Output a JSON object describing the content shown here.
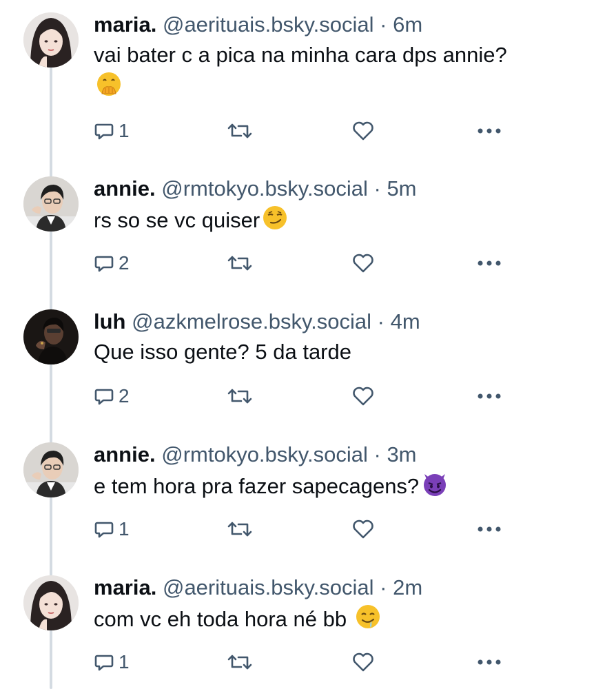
{
  "posts": [
    {
      "author": "maria.",
      "handle": "@aerituais.bsky.social",
      "separator": "·",
      "time": "6m",
      "text": "vai bater c a pica na minha cara dps annie?",
      "emoji": "hand-over-mouth-emoji",
      "reply_count": "1",
      "avatar": "avatar-maria"
    },
    {
      "author": "annie.",
      "handle": "@rmtokyo.bsky.social",
      "separator": "·",
      "time": "5m",
      "text": "rs so se vc quiser",
      "emoji": "smirk-emoji",
      "reply_count": "2",
      "avatar": "avatar-annie"
    },
    {
      "author": "luh",
      "handle": "@azkmelrose.bsky.social",
      "separator": "·",
      "time": "4m",
      "text": "Que isso gente? 5 da tarde",
      "emoji": "",
      "reply_count": "2",
      "avatar": "avatar-luh"
    },
    {
      "author": "annie.",
      "handle": "@rmtokyo.bsky.social",
      "separator": "·",
      "time": "3m",
      "text": "e tem hora pra fazer sapecagens?",
      "emoji": "smiling-devil-emoji",
      "reply_count": "1",
      "avatar": "avatar-annie"
    },
    {
      "author": "maria.",
      "handle": "@aerituais.bsky.social",
      "separator": "·",
      "time": "2m",
      "text": "com vc eh toda hora né bb",
      "emoji": "drooling-face-emoji",
      "reply_count": "1",
      "avatar": "avatar-maria"
    }
  ],
  "colors": {
    "text": "#0b0f14",
    "muted": "#42576c",
    "thread_line": "#d4dbe2",
    "emoji_yellow": "#f7c12a",
    "devil_purple": "#7a3fb8"
  }
}
